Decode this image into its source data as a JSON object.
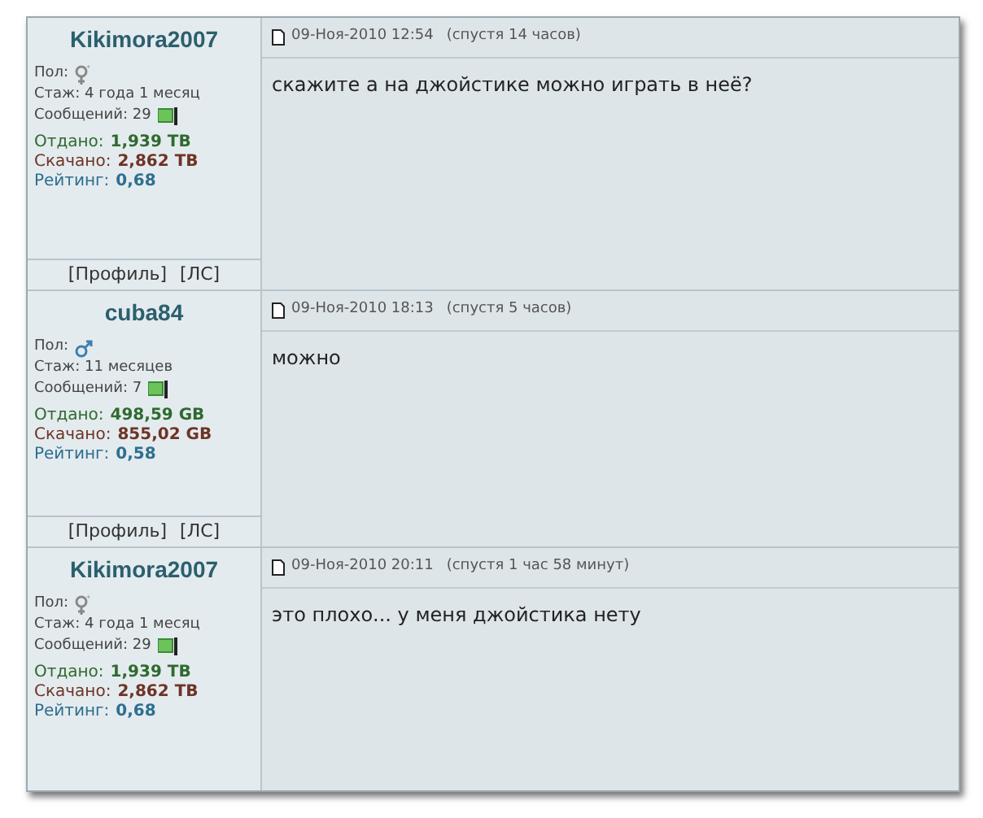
{
  "posts": [
    {
      "author": "Kikimora2007",
      "gender_label": "Пол:",
      "gender_icon": {
        "kind": "female"
      },
      "tenure": "Стаж: 4 года 1 месяц",
      "messages": "Сообщений: 29",
      "uploaded_label": "Отдано:",
      "uploaded": "1,939 TB",
      "downloaded_label": "Скачано:",
      "downloaded": "2,862 TB",
      "rating_label": "Рейтинг:",
      "rating": "0,68",
      "links": [
        "[Профиль]",
        "[ЛС]"
      ],
      "date": "09-Ноя-2010 12:54",
      "after": "(спустя 14 часов)",
      "text": "скажите а на джойстике можно играть в неё?"
    },
    {
      "author": "cuba84",
      "gender_label": "Пол:",
      "gender_icon": {
        "kind": "male"
      },
      "tenure": "Стаж: 11 месяцев",
      "messages": "Сообщений: 7",
      "uploaded_label": "Отдано:",
      "uploaded": "498,59 GB",
      "downloaded_label": "Скачано:",
      "downloaded": "855,02 GB",
      "rating_label": "Рейтинг:",
      "rating": "0,58",
      "links": [
        "[Профиль]",
        "[ЛС]"
      ],
      "date": "09-Ноя-2010 18:13",
      "after": "(спустя 5 часов)",
      "text": "можно"
    },
    {
      "author": "Kikimora2007",
      "gender_label": "Пол:",
      "gender_icon": {
        "kind": "female"
      },
      "tenure": "Стаж: 4 года 1 месяц",
      "messages": "Сообщений: 29",
      "uploaded_label": "Отдано:",
      "uploaded": "1,939 TB",
      "downloaded_label": "Скачано:",
      "downloaded": "2,862 TB",
      "rating_label": "Рейтинг:",
      "rating": "0,68",
      "date": "09-Ноя-2010 20:11",
      "after": "(спустя 1 час 58 минут)",
      "text": "это плохо... у меня джойстика нету"
    }
  ]
}
